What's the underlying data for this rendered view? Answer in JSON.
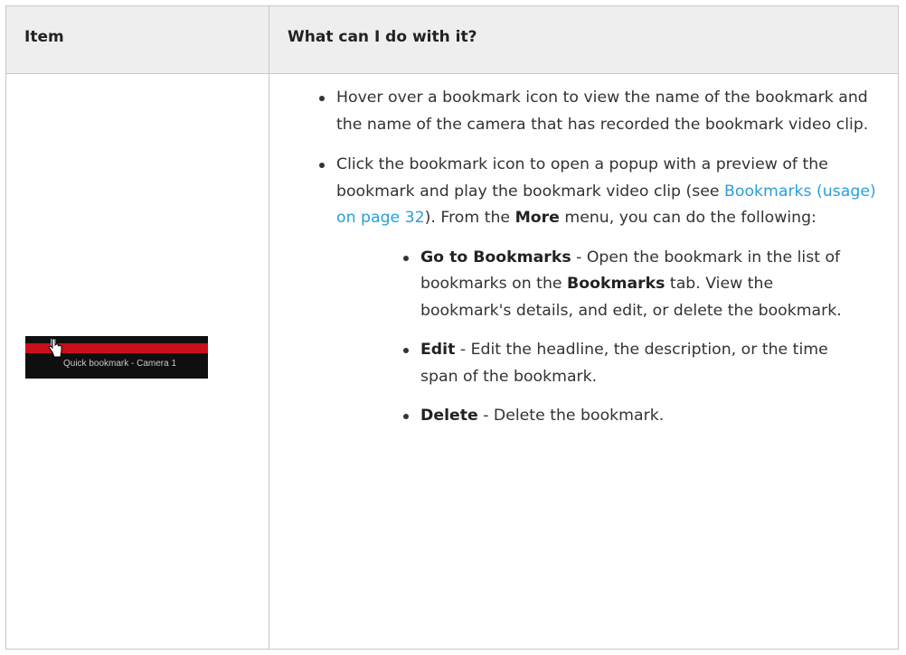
{
  "table": {
    "header_item": "Item",
    "header_action": "What can I do with it?"
  },
  "thumbnail": {
    "tooltip": "Quick bookmark - Camera 1"
  },
  "bullets": {
    "b1": "Hover over a bookmark icon to view the name of the bookmark and the name of the camera that has recorded the bookmark video clip.",
    "b2_pre": "Click the bookmark icon to open a popup with a preview of the bookmark and play the bookmark video clip (see ",
    "b2_link": "Bookmarks (usage) on page 32",
    "b2_mid": "). From the ",
    "b2_more": "More",
    "b2_post": " menu, you can do the following:"
  },
  "sub_bullets": {
    "s1_term": "Go to Bookmarks",
    "s1_pre": " - Open the bookmark in the list of bookmarks on the ",
    "s1_tab": "Bookmarks",
    "s1_post": " tab. View the bookmark's details, and edit, or delete the bookmark.",
    "s2_term": "Edit",
    "s2_text": " - Edit the headline, the description, or the time span of the bookmark.",
    "s3_term": "Delete",
    "s3_text": " - Delete the bookmark."
  },
  "colors": {
    "link": "#2a9fd8",
    "header_bg": "#eeeeee",
    "timeline_red": "#c8101a"
  }
}
